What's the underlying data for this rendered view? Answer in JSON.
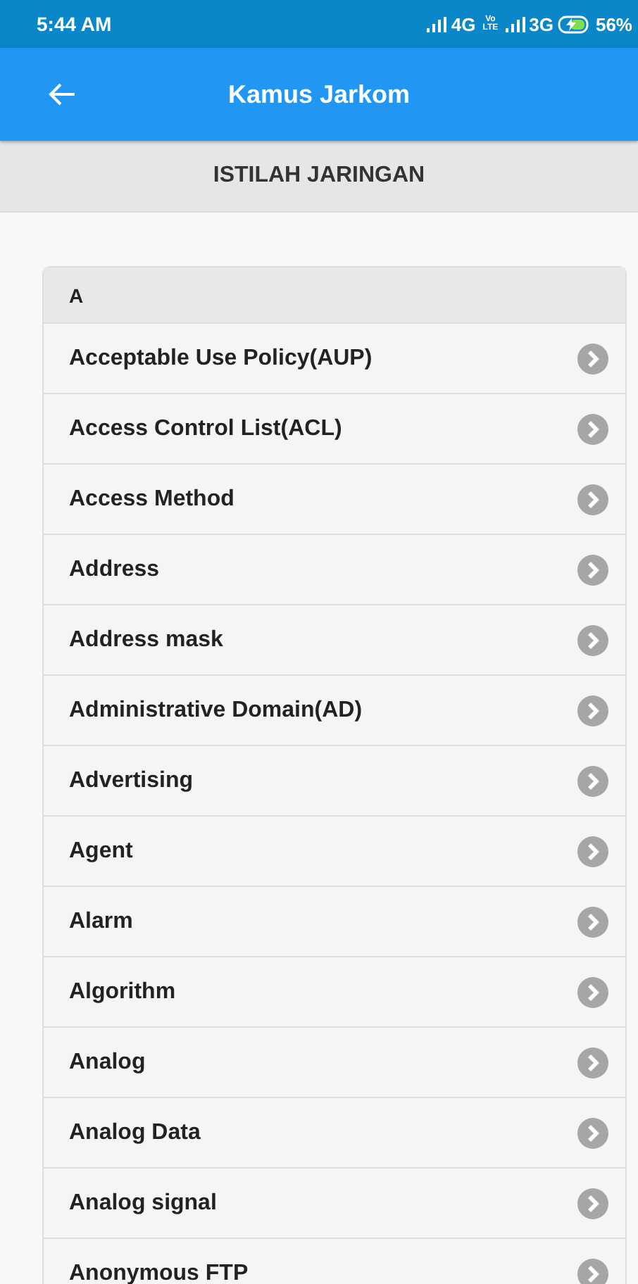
{
  "status_bar": {
    "time": "5:44 AM",
    "network_1": "4G",
    "volte": [
      "Vo",
      "LTE"
    ],
    "network_2": "3G",
    "battery": "56%"
  },
  "app_bar": {
    "title": "Kamus Jarkom"
  },
  "header": {
    "title": "ISTILAH JARINGAN"
  },
  "list": {
    "section": "A",
    "items": [
      "Acceptable Use Policy(AUP)",
      "Access Control List(ACL)",
      "Access Method",
      "Address",
      "Address mask",
      "Administrative Domain(AD)",
      "Advertising",
      "Agent",
      "Alarm",
      "Algorithm",
      "Analog",
      "Analog Data",
      "Analog signal",
      "Anonymous FTP"
    ]
  }
}
